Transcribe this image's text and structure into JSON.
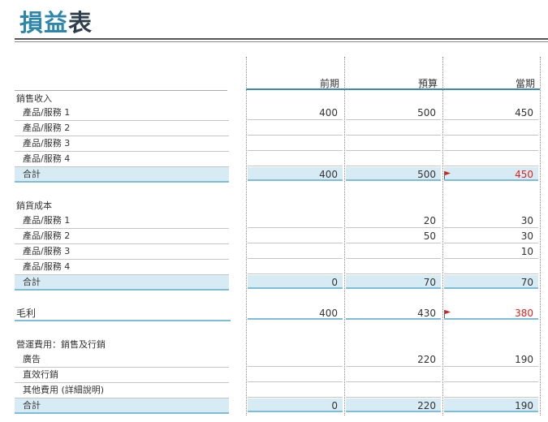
{
  "title": {
    "accent": "損益",
    "rest": "表"
  },
  "columns": {
    "c1": "前期",
    "c2": "預算",
    "c3": "當期"
  },
  "revenue": {
    "header": "銷售收入",
    "rows": [
      {
        "label": "產品/服務 1",
        "c1": "400",
        "c2": "500",
        "c3": "450"
      },
      {
        "label": "產品/服務 2",
        "c1": "",
        "c2": "",
        "c3": ""
      },
      {
        "label": "產品/服務 3",
        "c1": "",
        "c2": "",
        "c3": ""
      },
      {
        "label": "產品/服務 4",
        "c1": "",
        "c2": "",
        "c3": ""
      }
    ],
    "total": {
      "label": "合計",
      "c1": "400",
      "c2": "500",
      "c3": "450"
    }
  },
  "cogs": {
    "header": "銷貨成本",
    "rows": [
      {
        "label": "產品/服務 1",
        "c1": "",
        "c2": "20",
        "c3": "30"
      },
      {
        "label": "產品/服務 2",
        "c1": "",
        "c2": "50",
        "c3": "30"
      },
      {
        "label": "產品/服務 3",
        "c1": "",
        "c2": "",
        "c3": "10"
      },
      {
        "label": "產品/服務 4",
        "c1": "",
        "c2": "",
        "c3": ""
      }
    ],
    "total": {
      "label": "合計",
      "c1": "0",
      "c2": "70",
      "c3": "70"
    }
  },
  "gross": {
    "label": "毛利",
    "c1": "400",
    "c2": "430",
    "c3": "380"
  },
  "opex": {
    "header": "營運費用：銷售及行銷",
    "rows": [
      {
        "label": "廣告",
        "c1": "",
        "c2": "220",
        "c3": "190"
      },
      {
        "label": "直效行銷",
        "c1": "",
        "c2": "",
        "c3": ""
      },
      {
        "label": "其他費用 (詳細說明)",
        "c1": "",
        "c2": "",
        "c3": ""
      }
    ],
    "total": {
      "label": "合計",
      "c1": "0",
      "c2": "220",
      "c3": "190"
    }
  },
  "colors": {
    "accent": "#2e86ab",
    "total_fill": "#d7ebf4",
    "alert": "#e02020",
    "flag": "#d62020"
  },
  "icons": {
    "warning_flag": "flag-icon"
  }
}
